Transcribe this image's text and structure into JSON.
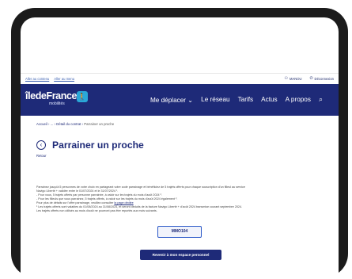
{
  "utility_bar": {
    "links": [
      "Aller au contenu",
      "Aller au menu"
    ],
    "user_label": "MANOU",
    "logout_label": "Déconnexion"
  },
  "header": {
    "logo_text": "îledeFrance",
    "logo_sub": "mobilités",
    "nav": [
      "Me déplacer",
      "Le réseau",
      "Tarifs",
      "Actus",
      "A propos"
    ]
  },
  "breadcrumb": {
    "items": [
      "Accueil",
      "...",
      "Détail du contrat"
    ],
    "current": "Parrainer un proche"
  },
  "page": {
    "title": "Parrainer un proche",
    "back_label": "Retour"
  },
  "content": {
    "lines": [
      "Parrainez jusqu'à 5 personnes de votre choix en partageant votre code parrainage et bénéficiez de 5 trajets offerts pour chaque souscription d'un filleul au service",
      "Navigo Liberté + validée entre le 01/07/2024 et le 31/07/2024 ¹.",
      "- Pour vous, 5 trajets offerts par personne parrainée, à valoir sur les trajets du mois d'août 2024 ².",
      "- Pour les filleuls que vous parrainez, 5 trajets offerts, à valoir sur les trajets du mois d'août 2024 également ².",
      "Pour plus de détails sur l'offre parrainage, veuillez consulter",
      "¹ Les trajets offerts sont valables du 01/08/2024 au 31/08/2024, et seront déduits de la facture Navigo Liberté + d'août 2024 transmise courant septembre 2024.",
      "Les trajets offerts non utilisés au mois d'août ne pourront pas être reportés aux mois suivants."
    ],
    "terms_link": "la page dédiée"
  },
  "referral_code": "MMO104",
  "return_button": "Revenir à mon espace personnel",
  "colors": {
    "brand": "#1e2a78",
    "accent": "#2aa8d8",
    "code_border": "#2b58c8"
  }
}
